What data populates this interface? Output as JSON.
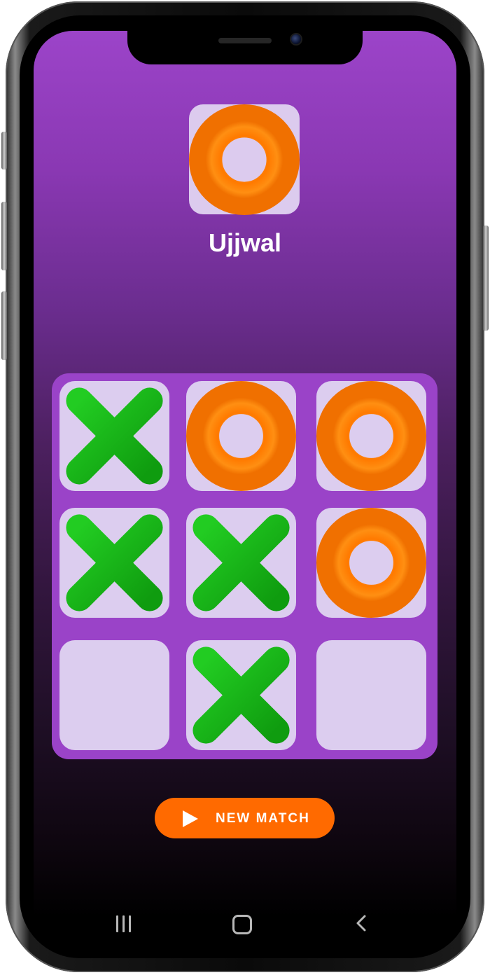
{
  "current_player": {
    "name": "Ujjwal",
    "symbol": "O"
  },
  "board": [
    [
      "X",
      "O",
      "O"
    ],
    [
      "X",
      "X",
      "O"
    ],
    [
      "",
      "X",
      ""
    ]
  ],
  "buttons": {
    "new_match": "NEW MATCH"
  },
  "colors": {
    "background_top": "#9c44c9",
    "background_bottom": "#000000",
    "board": "#9a43c8",
    "cell": "#dccdef",
    "x_mark": "#1fb91f",
    "o_mark": "#ff7a00",
    "button": "#ff6a00"
  },
  "icons": {
    "button": "play-icon",
    "nav": [
      "recents-icon",
      "home-icon",
      "back-icon"
    ]
  }
}
